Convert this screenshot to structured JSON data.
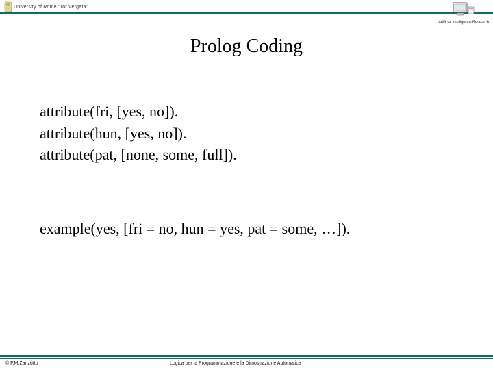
{
  "header": {
    "university": "University of Rome \"Tor Vergata\"",
    "ai_group": "Artificial Intelligence Research"
  },
  "title": "Prolog Coding",
  "code": {
    "line1": "attribute(fri, [yes, no]).",
    "line2": "attribute(hun, [yes, no]).",
    "line3": "attribute(pat, [none, some, full])."
  },
  "example": "example(yes, [fri = no, hun = yes, pat = some, …]).",
  "footer": {
    "copyright": "© F.M.Zanzotto",
    "course": "Logica per la Programmazione e la Dimostrazione Automatica"
  }
}
